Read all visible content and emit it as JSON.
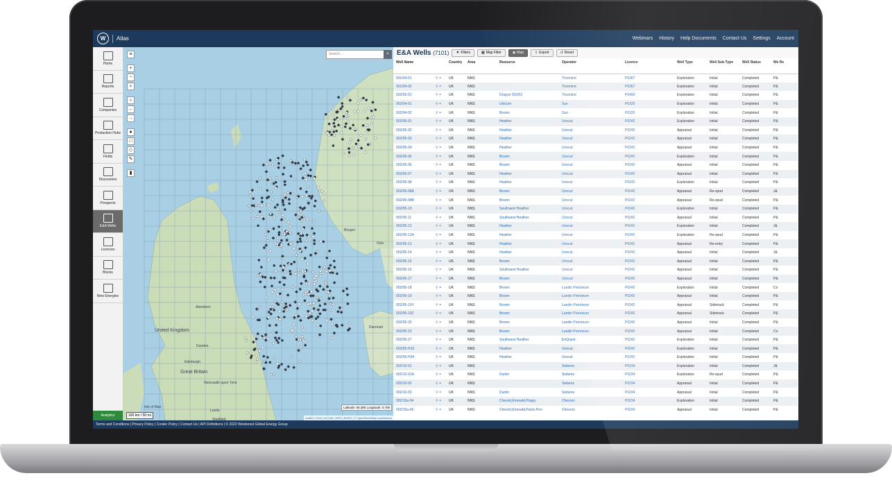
{
  "app": {
    "title": "Atlas",
    "logo_letter": "W",
    "topnav": [
      "Webinars",
      "History",
      "Help Documents",
      "Contact Us",
      "Settings",
      "Account"
    ]
  },
  "nav": [
    {
      "label": "Home",
      "icon": "home-icon"
    },
    {
      "label": "Reports",
      "icon": "reports-icon"
    },
    {
      "label": "Companies",
      "icon": "companies-icon"
    },
    {
      "label": "Production Hubs",
      "icon": "production-hubs-icon"
    },
    {
      "label": "Fields",
      "icon": "fields-icon"
    },
    {
      "label": "Discoveries",
      "icon": "discoveries-icon"
    },
    {
      "label": "Prospects",
      "icon": "prospects-icon"
    },
    {
      "label": "E&A Wells",
      "icon": "wells-icon",
      "active": true
    },
    {
      "label": "Licences",
      "icon": "licences-icon"
    },
    {
      "label": "Blocks",
      "icon": "blocks-icon"
    },
    {
      "label": "New Energies",
      "icon": "new-energies-icon"
    }
  ],
  "analytics_label": "Analytics",
  "map": {
    "search_placeholder": "Search...",
    "scale_text": "100 km / 50 mi",
    "coords": "Latitude: 58.385 Longitude: 0.708",
    "attribution": "Leaflet | OGA | DCCAE | NPD | BGEG | © OpenStreetMap contributors",
    "labels": [
      "Bergen",
      "Oslo",
      "Aberdeen",
      "Dundee",
      "Edinburgh",
      "Newcastle upon Tyne",
      "United Kingdom",
      "Great Britain",
      "Leeds",
      "Sheffield",
      "Danmark",
      "Isle of Man"
    ]
  },
  "panel": {
    "title": "E&A Wells",
    "count": "(7101)",
    "buttons": [
      "Filters",
      "Map Filter",
      "Map",
      "Export",
      "Reset"
    ],
    "columns": [
      "Well Name",
      "Country",
      "Area",
      "Resource",
      "Operator",
      "Licence",
      "Well Type",
      "Well Sub-Type",
      "Well Status",
      "We Re"
    ],
    "rows": [
      [
        "001/04-01",
        "UK",
        "NNS",
        "",
        "Tricentrol",
        "P0367",
        "Exploration",
        "Initial",
        "Completed",
        "P&"
      ],
      [
        "001/04-02",
        "UK",
        "NNS",
        "",
        "Tricentrol",
        "P0367",
        "Exploration",
        "Initial",
        "Completed",
        "P&"
      ],
      [
        "002/03-01",
        "UK",
        "NNS",
        "Dragon 002/03",
        "Tricentrol",
        "P0490",
        "Exploration",
        "Initial",
        "Completed",
        "P&"
      ],
      [
        "002/04-01",
        "UK",
        "NNS",
        "Unicorn",
        "Sun",
        "P0325",
        "Exploration",
        "Initial",
        "Completed",
        "P&"
      ],
      [
        "002/04-02",
        "UK",
        "NNS",
        "Broom",
        "Sun",
        "P0325",
        "Exploration",
        "Initial",
        "Completed",
        "P&"
      ],
      [
        "002/05-01",
        "UK",
        "NNS",
        "Heather",
        "Unocal",
        "P0242",
        "Exploration",
        "Initial",
        "Completed",
        "P&"
      ],
      [
        "002/05-02",
        "UK",
        "NNS",
        "Heather",
        "Unocal",
        "P0242",
        "Appraisal",
        "Initial",
        "Completed",
        "P&"
      ],
      [
        "002/05-03",
        "UK",
        "NNS",
        "Heather",
        "Unocal",
        "P0242",
        "Appraisal",
        "Initial",
        "Completed",
        "P&"
      ],
      [
        "002/05-04",
        "UK",
        "NNS",
        "Heather",
        "Unocal",
        "P0242",
        "Appraisal",
        "Initial",
        "Completed",
        "P&"
      ],
      [
        "002/05-05",
        "UK",
        "NNS",
        "Broom",
        "Unocal",
        "P0242",
        "Exploration",
        "Initial",
        "Completed",
        "P&"
      ],
      [
        "002/05-06",
        "UK",
        "NNS",
        "Broom",
        "Unocal",
        "P0242",
        "Appraisal",
        "Initial",
        "Completed",
        "P&"
      ],
      [
        "002/05-07",
        "UK",
        "NNS",
        "Heather",
        "Unocal",
        "P0242",
        "Appraisal",
        "Initial",
        "Completed",
        "P&"
      ],
      [
        "002/05-08",
        "UK",
        "NNS",
        "Heather",
        "Unocal",
        "P0242",
        "Exploration",
        "Initial",
        "Completed",
        "P&"
      ],
      [
        "002/05-08A",
        "UK",
        "NNS",
        "Broom",
        "Unocal",
        "P0242",
        "Appraisal",
        "Re-spud",
        "Completed",
        "J&"
      ],
      [
        "002/05-08B",
        "UK",
        "NNS",
        "Broom",
        "Unocal",
        "P0242",
        "Appraisal",
        "Re-spud",
        "Completed",
        "P&"
      ],
      [
        "002/05-10",
        "UK",
        "NNS",
        "Southwest Heather",
        "Unocal",
        "P0242",
        "Exploration",
        "Initial",
        "Completed",
        "P&"
      ],
      [
        "002/05-11",
        "UK",
        "NNS",
        "Southwest Heather",
        "Unocal",
        "P0242",
        "Appraisal",
        "Initial",
        "Completed",
        "P&"
      ],
      [
        "002/05-12",
        "UK",
        "NNS",
        "Heather",
        "Unocal",
        "P0242",
        "Exploration",
        "Initial",
        "Completed",
        "J&"
      ],
      [
        "002/05-12A",
        "UK",
        "NNS",
        "Heather",
        "Unocal",
        "P0242",
        "Exploration",
        "Re-spud",
        "Completed",
        "P&"
      ],
      [
        "002/05-13",
        "UK",
        "NNS",
        "Heather",
        "Unocal",
        "P0242",
        "Appraisal",
        "Re-entry",
        "Completed",
        "P&"
      ],
      [
        "002/05-14",
        "UK",
        "NNS",
        "Heather",
        "Unocal",
        "P0242",
        "Appraisal",
        "Initial",
        "Completed",
        "J&"
      ],
      [
        "002/05-15",
        "UK",
        "NNS",
        "Broom",
        "Unocal",
        "P0242",
        "Appraisal",
        "Initial",
        "Completed",
        "P&"
      ],
      [
        "002/05-16",
        "UK",
        "NNS",
        "Southwest Heather",
        "Unocal",
        "P0242",
        "Appraisal",
        "Initial",
        "Completed",
        "P&"
      ],
      [
        "002/05-17",
        "UK",
        "NNS",
        "Broom",
        "Unocal",
        "P0242",
        "Appraisal",
        "Initial",
        "Completed",
        "P&"
      ],
      [
        "002/05-18",
        "UK",
        "NNS",
        "Broom",
        "Lundin Petroleum",
        "P0242",
        "Exploration",
        "Initial",
        "Completed",
        "Co"
      ],
      [
        "002/05-19",
        "UK",
        "NNS",
        "Broom",
        "Lundin Petroleum",
        "P0242",
        "Appraisal",
        "Initial",
        "Completed",
        "P&"
      ],
      [
        "002/05-19Y",
        "UK",
        "NNS",
        "Broom",
        "Lundin Petroleum",
        "P0242",
        "Appraisal",
        "Sidetrack",
        "Completed",
        "P&"
      ],
      [
        "002/05-19Z",
        "UK",
        "NNS",
        "Broom",
        "Lundin Petroleum",
        "P0242",
        "Appraisal",
        "Sidetrack",
        "Completed",
        "P&"
      ],
      [
        "002/05-20",
        "UK",
        "NNS",
        "Broom",
        "Lundin Petroleum",
        "P0242",
        "Appraisal",
        "Initial",
        "Completed",
        "P&"
      ],
      [
        "002/05-23",
        "UK",
        "NNS",
        "Broom",
        "Lundin Petroleum",
        "P0242",
        "Appraisal",
        "Initial",
        "Completed",
        "Co"
      ],
      [
        "002/05-27",
        "UK",
        "NNS",
        "Southwest Heather",
        "EnQuest",
        "P0242",
        "Exploration",
        "Initial",
        "Completed",
        "P&"
      ],
      [
        "002/05-H19",
        "UK",
        "NNS",
        "Heather",
        "Unocal",
        "P0242",
        "Exploration",
        "Initial",
        "Completed",
        "P&"
      ],
      [
        "002/05-H34",
        "UK",
        "NNS",
        "Heather",
        "Unocal",
        "P0242",
        "Exploration",
        "Initial",
        "Completed",
        "P&"
      ],
      [
        "002/10-01",
        "UK",
        "NNS",
        "",
        "Siebens",
        "P0234",
        "Exploration",
        "Initial",
        "Completed",
        "J&"
      ],
      [
        "002/10-01A",
        "UK",
        "NNS",
        "Dunlin",
        "Siebens",
        "P0234",
        "Exploration",
        "Re-spud",
        "Completed",
        "P&"
      ],
      [
        "002/10-02",
        "UK",
        "NNS",
        "",
        "Siebens",
        "P0234",
        "Appraisal",
        "Initial",
        "Completed",
        "P&"
      ],
      [
        "002/10-03",
        "UK",
        "NNS",
        "Dunlin",
        "Siebens",
        "P0234",
        "Appraisal",
        "Initial",
        "Completed",
        "P&"
      ],
      [
        "002/10a-04",
        "UK",
        "NNS",
        "Cheviot,Emerald,Poppy",
        "Chevron",
        "P0234",
        "Exploration",
        "Initial",
        "Completed",
        "P&"
      ],
      [
        "002/10a-06",
        "UK",
        "NNS",
        "Cheviot,Emerald,Paton,Peri",
        "Chevron",
        "P0234",
        "Appraisal",
        "Initial",
        "Completed",
        "P&"
      ]
    ]
  },
  "footer": "Terms and Conditions | Privacy Policy | Cookie Policy | Contact Us | API Definitions | © 2022 Westwood Global Energy Group",
  "colors": {
    "topbar": "#1d3a5c",
    "link": "#2a6bb0",
    "analytics": "#2e8b3d"
  }
}
